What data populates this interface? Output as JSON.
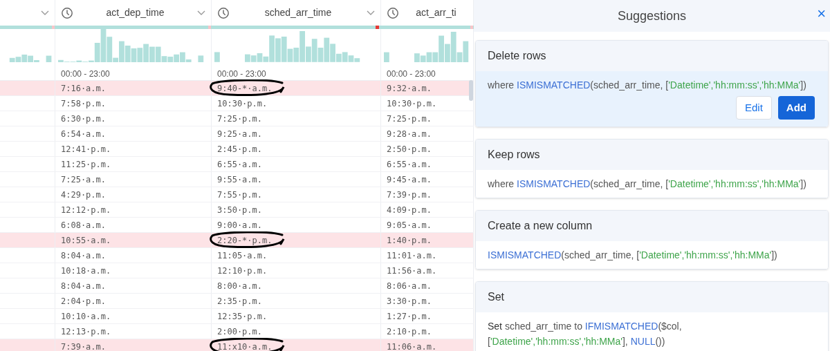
{
  "table": {
    "columns": [
      {
        "kind": "cut",
        "has_menu": true
      },
      {
        "kind": "time",
        "label": "act_dep_time",
        "has_menu": true,
        "range": "00:00 - 23:00"
      },
      {
        "kind": "time",
        "label": "sched_arr_time",
        "has_menu": true,
        "range": "00:00 - 23:00"
      },
      {
        "kind": "time",
        "label": "act_arr_ti",
        "has_menu": false,
        "range": "00:00 - 23:00"
      }
    ],
    "rows": [
      {
        "mismatched": true,
        "circled": true,
        "cells": [
          "",
          "7:16·a.m.",
          "9:40-*·a.m.",
          "9:32·a.m."
        ]
      },
      {
        "mismatched": false,
        "circled": false,
        "cells": [
          "",
          "7:58·p.m.",
          "10:30·p.m.",
          "10:30·p.m."
        ]
      },
      {
        "mismatched": false,
        "circled": false,
        "cells": [
          "",
          "6:30·p.m.",
          "7:25·p.m.",
          "7:25·p.m."
        ]
      },
      {
        "mismatched": false,
        "circled": false,
        "cells": [
          "",
          "6:54·a.m.",
          "9:25·a.m.",
          "9:28·a.m."
        ]
      },
      {
        "mismatched": false,
        "circled": false,
        "cells": [
          "",
          "12:41·p.m.",
          "2:45·p.m.",
          "2:50·p.m."
        ]
      },
      {
        "mismatched": false,
        "circled": false,
        "cells": [
          "",
          "11:25·p.m.",
          "6:55·a.m.",
          "6:55·a.m."
        ]
      },
      {
        "mismatched": false,
        "circled": false,
        "cells": [
          "",
          "7:25·a.m.",
          "9:55·a.m.",
          "9:45·a.m."
        ]
      },
      {
        "mismatched": false,
        "circled": false,
        "cells": [
          "",
          "4:29·p.m.",
          "7:55·p.m.",
          "7:39·p.m."
        ]
      },
      {
        "mismatched": false,
        "circled": false,
        "cells": [
          "",
          "12:12·p.m.",
          "3:50·p.m.",
          "4:09·p.m."
        ]
      },
      {
        "mismatched": false,
        "circled": false,
        "cells": [
          "",
          "6:08·a.m.",
          "9:00·a.m.",
          "9:05·a.m."
        ]
      },
      {
        "mismatched": true,
        "circled": true,
        "cells": [
          "",
          "10:55·a.m.",
          "2:20-*·p.m.",
          "1:40·p.m."
        ]
      },
      {
        "mismatched": false,
        "circled": false,
        "cells": [
          "",
          "8:04·a.m.",
          "11:05·a.m.",
          "11:01·a.m."
        ]
      },
      {
        "mismatched": false,
        "circled": false,
        "cells": [
          "",
          "10:18·a.m.",
          "12:10·p.m.",
          "11:56·a.m."
        ]
      },
      {
        "mismatched": false,
        "circled": false,
        "cells": [
          "",
          "8:04·a.m.",
          "8:00·a.m.",
          "8:06·a.m."
        ]
      },
      {
        "mismatched": false,
        "circled": false,
        "cells": [
          "",
          "2:04·p.m.",
          "2:35·p.m.",
          "3:30·p.m."
        ]
      },
      {
        "mismatched": false,
        "circled": false,
        "cells": [
          "",
          "10:10·a.m.",
          "12:35·p.m.",
          "1:27·p.m."
        ]
      },
      {
        "mismatched": false,
        "circled": false,
        "cells": [
          "",
          "12:13·p.m.",
          "2:00·p.m.",
          "2:10·p.m."
        ]
      },
      {
        "mismatched": true,
        "circled": true,
        "cells": [
          "",
          "7:39·a.m.",
          "11:x10·a.m.",
          "11:06·a.m."
        ]
      }
    ]
  },
  "suggestions": {
    "title": "Suggestions",
    "close": "×",
    "cards": [
      {
        "title": "Delete rows",
        "selected": true,
        "tokens": [
          {
            "kind": "plain",
            "text": "where "
          },
          {
            "kind": "fn",
            "text": "ISMISMATCHED"
          },
          {
            "kind": "plain",
            "text": "(sched_arr_time, ["
          },
          {
            "kind": "str",
            "text": "'Datetime','hh:mm:ss','hh:MMa'"
          },
          {
            "kind": "plain",
            "text": "])"
          }
        ],
        "buttons": [
          "Edit",
          "Add"
        ]
      },
      {
        "title": "Keep rows",
        "selected": false,
        "tokens": [
          {
            "kind": "plain",
            "text": "where "
          },
          {
            "kind": "fn",
            "text": "ISMISMATCHED"
          },
          {
            "kind": "plain",
            "text": "(sched_arr_time, ["
          },
          {
            "kind": "str",
            "text": "'Datetime','hh:mm:ss','hh:MMa'"
          },
          {
            "kind": "plain",
            "text": "])"
          }
        ]
      },
      {
        "title": "Create a new column",
        "selected": false,
        "tokens": [
          {
            "kind": "fn",
            "text": "ISMISMATCHED"
          },
          {
            "kind": "plain",
            "text": "(sched_arr_time, ["
          },
          {
            "kind": "str",
            "text": "'Datetime','hh:mm:ss','hh:MMa'"
          },
          {
            "kind": "plain",
            "text": "])"
          }
        ]
      },
      {
        "title": "Set",
        "selected": false,
        "tokens": [
          {
            "kind": "keyword",
            "text": "Set"
          },
          {
            "kind": "plain",
            "text": " sched_arr_time to "
          },
          {
            "kind": "fn",
            "text": "IFMISMATCHED"
          },
          {
            "kind": "plain",
            "text": "($col,"
          },
          {
            "kind": "break"
          },
          {
            "kind": "plain",
            "text": "["
          },
          {
            "kind": "str",
            "text": "'Datetime','hh:mm:ss','hh:MMa'"
          },
          {
            "kind": "plain",
            "text": "], "
          },
          {
            "kind": "fn",
            "text": "NULL"
          },
          {
            "kind": "plain",
            "text": "())"
          }
        ]
      }
    ]
  }
}
